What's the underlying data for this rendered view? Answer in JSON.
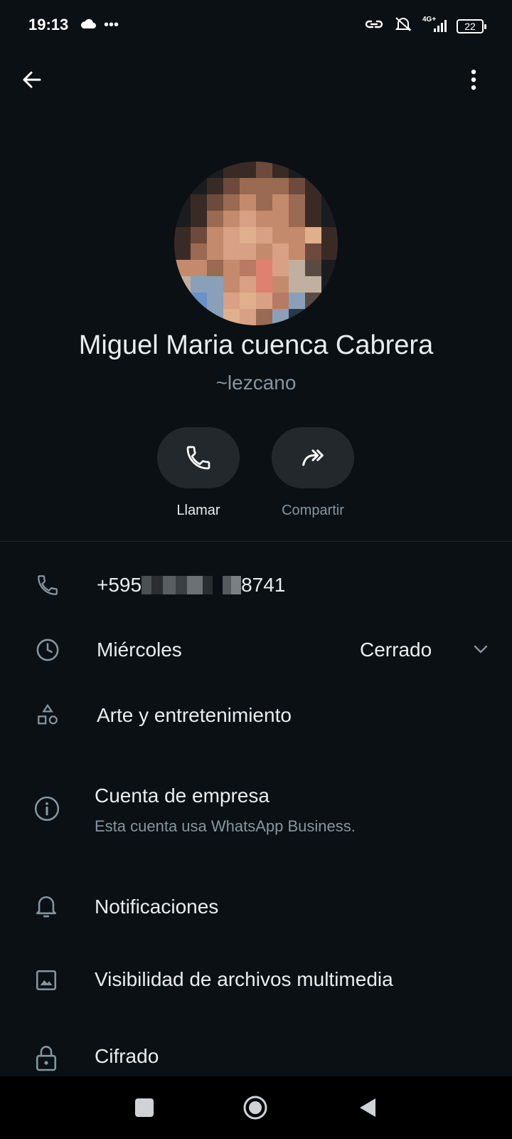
{
  "status_bar": {
    "time": "19:13",
    "battery": "22",
    "network": "4G+"
  },
  "header": {
    "back_icon": "arrow-left-icon",
    "menu_icon": "more-vertical-icon"
  },
  "profile": {
    "name": "Miguel Maria cuenca Cabrera",
    "username": "~lezcano"
  },
  "actions": [
    {
      "label": "Llamar",
      "icon": "phone-icon"
    },
    {
      "label": "Compartir",
      "icon": "share-icon"
    }
  ],
  "info": {
    "phone_prefix": "+595",
    "phone_suffix": "8741",
    "hours_day": "Miércoles",
    "hours_status": "Cerrado",
    "category": "Arte y entretenimiento",
    "business_title": "Cuenta de empresa",
    "business_sub": "Esta cuenta usa WhatsApp Business.",
    "notifications": "Notificaciones",
    "media_visibility": "Visibilidad de archivos multimedia",
    "encryption": "Cifrado"
  },
  "colors": {
    "background": "#0b1014",
    "text_primary": "#e9edef",
    "text_secondary": "#8696a0",
    "button_bg": "#23282c"
  }
}
